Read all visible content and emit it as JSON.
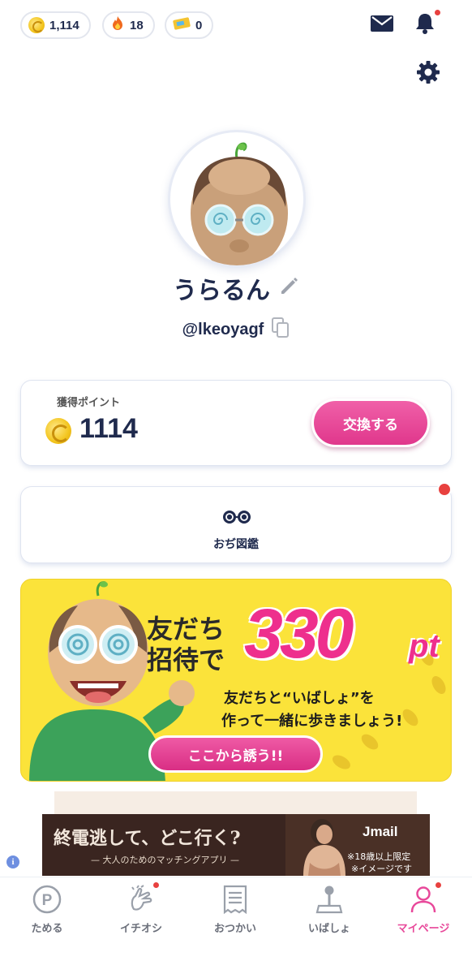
{
  "status": {
    "coins": "1,114",
    "streak": "18",
    "tickets": "0"
  },
  "profile": {
    "name": "うらるん",
    "handle": "@lkeoyagf"
  },
  "points_card": {
    "label": "獲得ポイント",
    "value": "1114",
    "exchange_label": "交換する"
  },
  "zukan": {
    "label": "おぢ図鑑"
  },
  "banner": {
    "line1": "友だち",
    "line2": "招待で",
    "amount": "330",
    "unit": "pt",
    "sub1": "友だちと“いばしょ”を",
    "sub2": "作って一緒に歩きましょう!",
    "cta": "ここから誘う!!"
  },
  "ad": {
    "headline": "終電逃して、どこ行く?",
    "tagline": "— 大人のためのマッチングアプリ —",
    "brand": "Jmail",
    "note1": "※18歳以上限定",
    "note2": "※イメージです",
    "info": "i"
  },
  "nav": {
    "items": [
      {
        "label": "ためる",
        "icon": "p-coin-icon"
      },
      {
        "label": "イチオシ",
        "icon": "hand-heart-icon"
      },
      {
        "label": "おつかい",
        "icon": "receipt-icon"
      },
      {
        "label": "いばしょ",
        "icon": "joystick-icon"
      },
      {
        "label": "マイページ",
        "icon": "person-icon"
      }
    ],
    "active": "マイページ"
  },
  "colors": {
    "navy": "#1f2a4d",
    "pink": "#e8489a",
    "banner_yellow": "#fbe33a",
    "badge_red": "#e8413f"
  }
}
